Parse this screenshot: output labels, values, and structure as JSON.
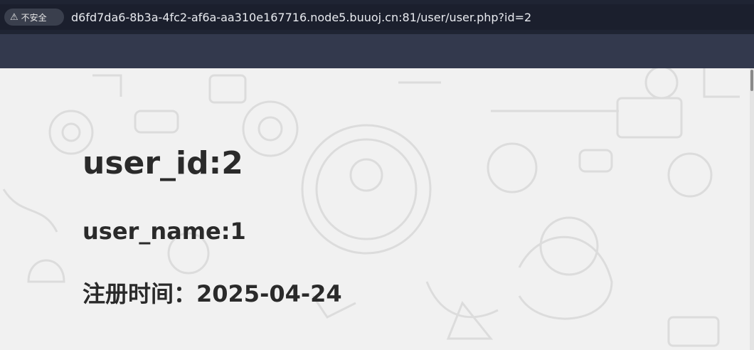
{
  "browser": {
    "security_label": "不安全",
    "url": "d6fd7da6-8b3a-4fc2-af6a-aa310e167716.node5.buuoj.cn:81/user/user.php?id=2"
  },
  "page": {
    "user_id": "user_id:2",
    "user_name": "user_name:1",
    "register_time": "注册时间：2025-04-24"
  },
  "colors": {
    "titlebar": "#1f2433",
    "toolbar": "#33394d",
    "background": "#f1f1f1",
    "text": "#2a2a2a"
  }
}
